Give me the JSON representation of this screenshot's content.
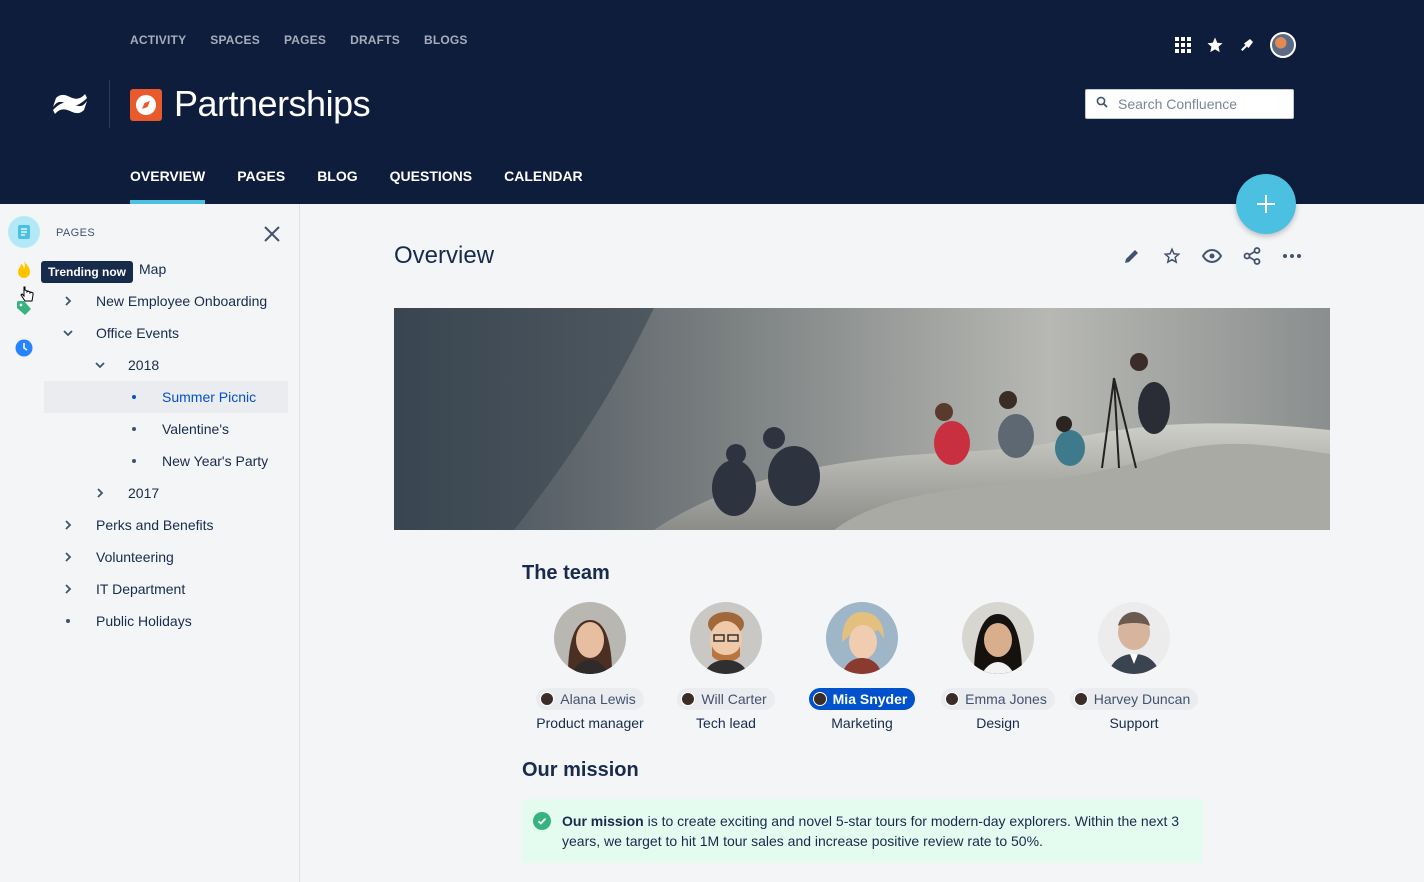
{
  "topnav": [
    "ACTIVITY",
    "SPACES",
    "PAGES",
    "DRAFTS",
    "BLOGS"
  ],
  "top_icons": [
    "apps-grid-icon",
    "star-icon",
    "notification-icon",
    "user-avatar"
  ],
  "space": {
    "title": "Partnerships",
    "icon": "compass-icon"
  },
  "search": {
    "placeholder": "Search Confluence"
  },
  "space_tabs": [
    "OVERVIEW",
    "PAGES",
    "BLOG",
    "QUESTIONS",
    "CALENDAR"
  ],
  "active_tab": "OVERVIEW",
  "sidebar": {
    "heading": "PAGES",
    "tooltip": "Trending now",
    "tree": [
      {
        "label": "Map",
        "type": "partial"
      },
      {
        "label": "New Employee Onboarding",
        "type": "collapsed",
        "level": 0
      },
      {
        "label": "Office Events",
        "type": "expanded",
        "level": 0
      },
      {
        "label": "2018",
        "type": "expanded",
        "level": 1
      },
      {
        "label": "Summer Picnic",
        "type": "leaf",
        "level": 2,
        "selected": true
      },
      {
        "label": "Valentine's",
        "type": "leaf",
        "level": 2
      },
      {
        "label": "New Year's Party",
        "type": "leaf",
        "level": 2
      },
      {
        "label": "2017",
        "type": "collapsed",
        "level": 1
      },
      {
        "label": "Perks and Benefits",
        "type": "collapsed",
        "level": 0
      },
      {
        "label": "Volunteering",
        "type": "collapsed",
        "level": 0
      },
      {
        "label": "IT Department",
        "type": "collapsed",
        "level": 0
      },
      {
        "label": "Public Holidays",
        "type": "leaf",
        "level": 0
      }
    ]
  },
  "page": {
    "title": "Overview",
    "actions": [
      "edit-icon",
      "star-icon",
      "watch-icon",
      "share-icon",
      "more-icon"
    ]
  },
  "team": {
    "heading": "The team",
    "members": [
      {
        "name": "Alana Lewis",
        "role": "Product manager"
      },
      {
        "name": "Will Carter",
        "role": "Tech lead"
      },
      {
        "name": "Mia Snyder",
        "role": "Marketing",
        "current_user": true
      },
      {
        "name": "Emma Jones",
        "role": "Design"
      },
      {
        "name": "Harvey Duncan",
        "role": "Support"
      }
    ]
  },
  "mission": {
    "heading": "Our mission",
    "bold": "Our mission",
    "text": " is to create exciting and novel 5-star tours for modern-day explorers. Within the next 3 years, we target to hit 1M tour sales and increase positive review rate to 50%."
  },
  "colors": {
    "header": "#0F1D3D",
    "accent": "#4BC0E0",
    "link": "#0052CC",
    "success_bg": "#E3FCEF"
  }
}
